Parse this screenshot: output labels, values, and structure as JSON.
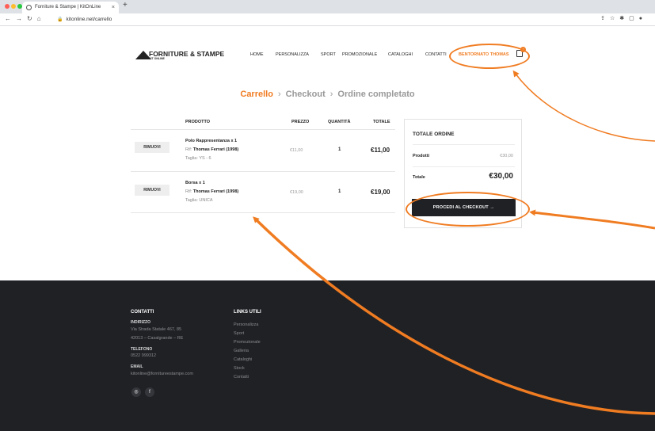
{
  "browser": {
    "tab_title": "Forniture & Stampe | KitOnLine",
    "tab_close": "×",
    "new_tab": "+",
    "address": "kitonline.net/carrello",
    "colors": {
      "chrome_bg": "#dee1e6",
      "close_dot": "#ff5f57",
      "min_dot": "#febc2e",
      "max_dot": "#28c840"
    }
  },
  "site": {
    "logo": {
      "title": "FORNITURE & STAMPE",
      "subtitle": "KIT ONLINE"
    },
    "nav": {
      "home": "HOME",
      "personalizza": "PERSONALIZZA",
      "sport": "SPORT",
      "promozionale": "PROMOZIONALE",
      "cataloghi": "CATALOGHI",
      "contatti": "CONTATTI",
      "user": "BENTORNATO THOMAS"
    },
    "cart_count": "2"
  },
  "steps": {
    "cart": "Carrello",
    "checkout": "Checkout",
    "done": "Ordine completato",
    "separator": "›"
  },
  "cart_table": {
    "headers": {
      "product": "PRODOTTO",
      "price": "PREZZO",
      "qty": "QUANTITÀ",
      "total": "TOTALE"
    },
    "rows": [
      {
        "remove": "RIMUOVI",
        "name": "Polo Rappresentanza x 1",
        "ref_label": "Rif:",
        "ref_value": "Thomas Ferrari (1998)",
        "size": "Taglia: YS - 6",
        "price": "€11,00",
        "qty": "1",
        "total": "€11,00"
      },
      {
        "remove": "RIMUOVI",
        "name": "Borsa x 1",
        "ref_label": "Rif:",
        "ref_value": "Thomas Ferrari (1998)",
        "size": "Taglia: UNICA",
        "price": "€19,00",
        "qty": "1",
        "total": "€19,00"
      }
    ]
  },
  "summary": {
    "title": "TOTALE ORDINE",
    "products_label": "Prodotti",
    "products_value": "€30,00",
    "total_label": "Totale",
    "total_value": "€30,00",
    "checkout_button": "PROCEDI AL CHECKOUT →"
  },
  "footer": {
    "contacts": {
      "heading": "CONTATTI",
      "address_label": "INDIRIZZO",
      "address_line1": "Via Strada Statale 467, 85",
      "address_line2": "42013 – Casalgrande – RE",
      "phone_label": "TELEFONO",
      "phone": "0522 999312",
      "email_label": "EMAIL",
      "email": "kitonline@fornitureestampe.com"
    },
    "links": {
      "heading": "LINKS UTILI",
      "items": [
        "Personalizza",
        "Sport",
        "Promozionale",
        "Galleria",
        "Cataloghi",
        "Stock",
        "Contatti"
      ]
    },
    "social": {
      "instagram": "◎",
      "facebook": "f"
    }
  },
  "colors": {
    "accent": "#f07c22",
    "dark": "#1f2125"
  }
}
